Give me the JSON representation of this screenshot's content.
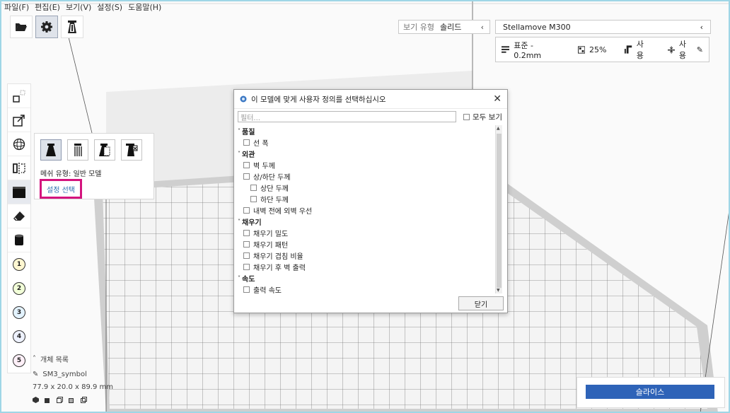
{
  "menu": [
    "파일(F)",
    "편집(E)",
    "보기(V)",
    "설정(S)",
    "도움말(H)"
  ],
  "view_type": {
    "label": "보기 유형",
    "value": "솔리드"
  },
  "printer": {
    "name": "Stellamove M300"
  },
  "profile": {
    "quality": "표준 - 0.2mm",
    "infill": "25%",
    "support": "사용",
    "adhesion": "사용"
  },
  "extruders": [
    "1",
    "2",
    "3",
    "4",
    "5"
  ],
  "mesh_panel": {
    "mesh_type": "메쉬 유형: 일반 모델",
    "select_settings": "설정 선택"
  },
  "object_panel": {
    "title": "개체 목록",
    "object_name": "SM3_symbol",
    "dimensions": "77.9 x 20.0 x 89.9 mm"
  },
  "slice_button": "슬라이스",
  "dialog": {
    "title": "이 모델에 맞게 사용자 정의를 선택하십시오",
    "filter_placeholder": "필터...",
    "show_all": "모두 보기",
    "close": "닫기",
    "categories": [
      {
        "name": "품질",
        "items": [
          {
            "label": "선 폭",
            "indent": 0
          }
        ]
      },
      {
        "name": "외관",
        "items": [
          {
            "label": "벽 두께",
            "indent": 0
          },
          {
            "label": "상/하단 두께",
            "indent": 0
          },
          {
            "label": "상단 두께",
            "indent": 1
          },
          {
            "label": "하단 두께",
            "indent": 1
          },
          {
            "label": "내벽 전에 외벽 우선",
            "indent": 0
          }
        ]
      },
      {
        "name": "채우기",
        "items": [
          {
            "label": "채우기 밀도",
            "indent": 0
          },
          {
            "label": "채우기 패턴",
            "indent": 0
          },
          {
            "label": "채우기 겹침 비율",
            "indent": 0
          },
          {
            "label": "채우기 후 벽 출력",
            "indent": 0
          }
        ]
      },
      {
        "name": "속도",
        "items": [
          {
            "label": "출력 속도",
            "indent": 0
          }
        ]
      }
    ]
  },
  "colors": {
    "accent": "#2e63b8",
    "highlight": "#d4147e",
    "link": "#2d6fb0"
  }
}
